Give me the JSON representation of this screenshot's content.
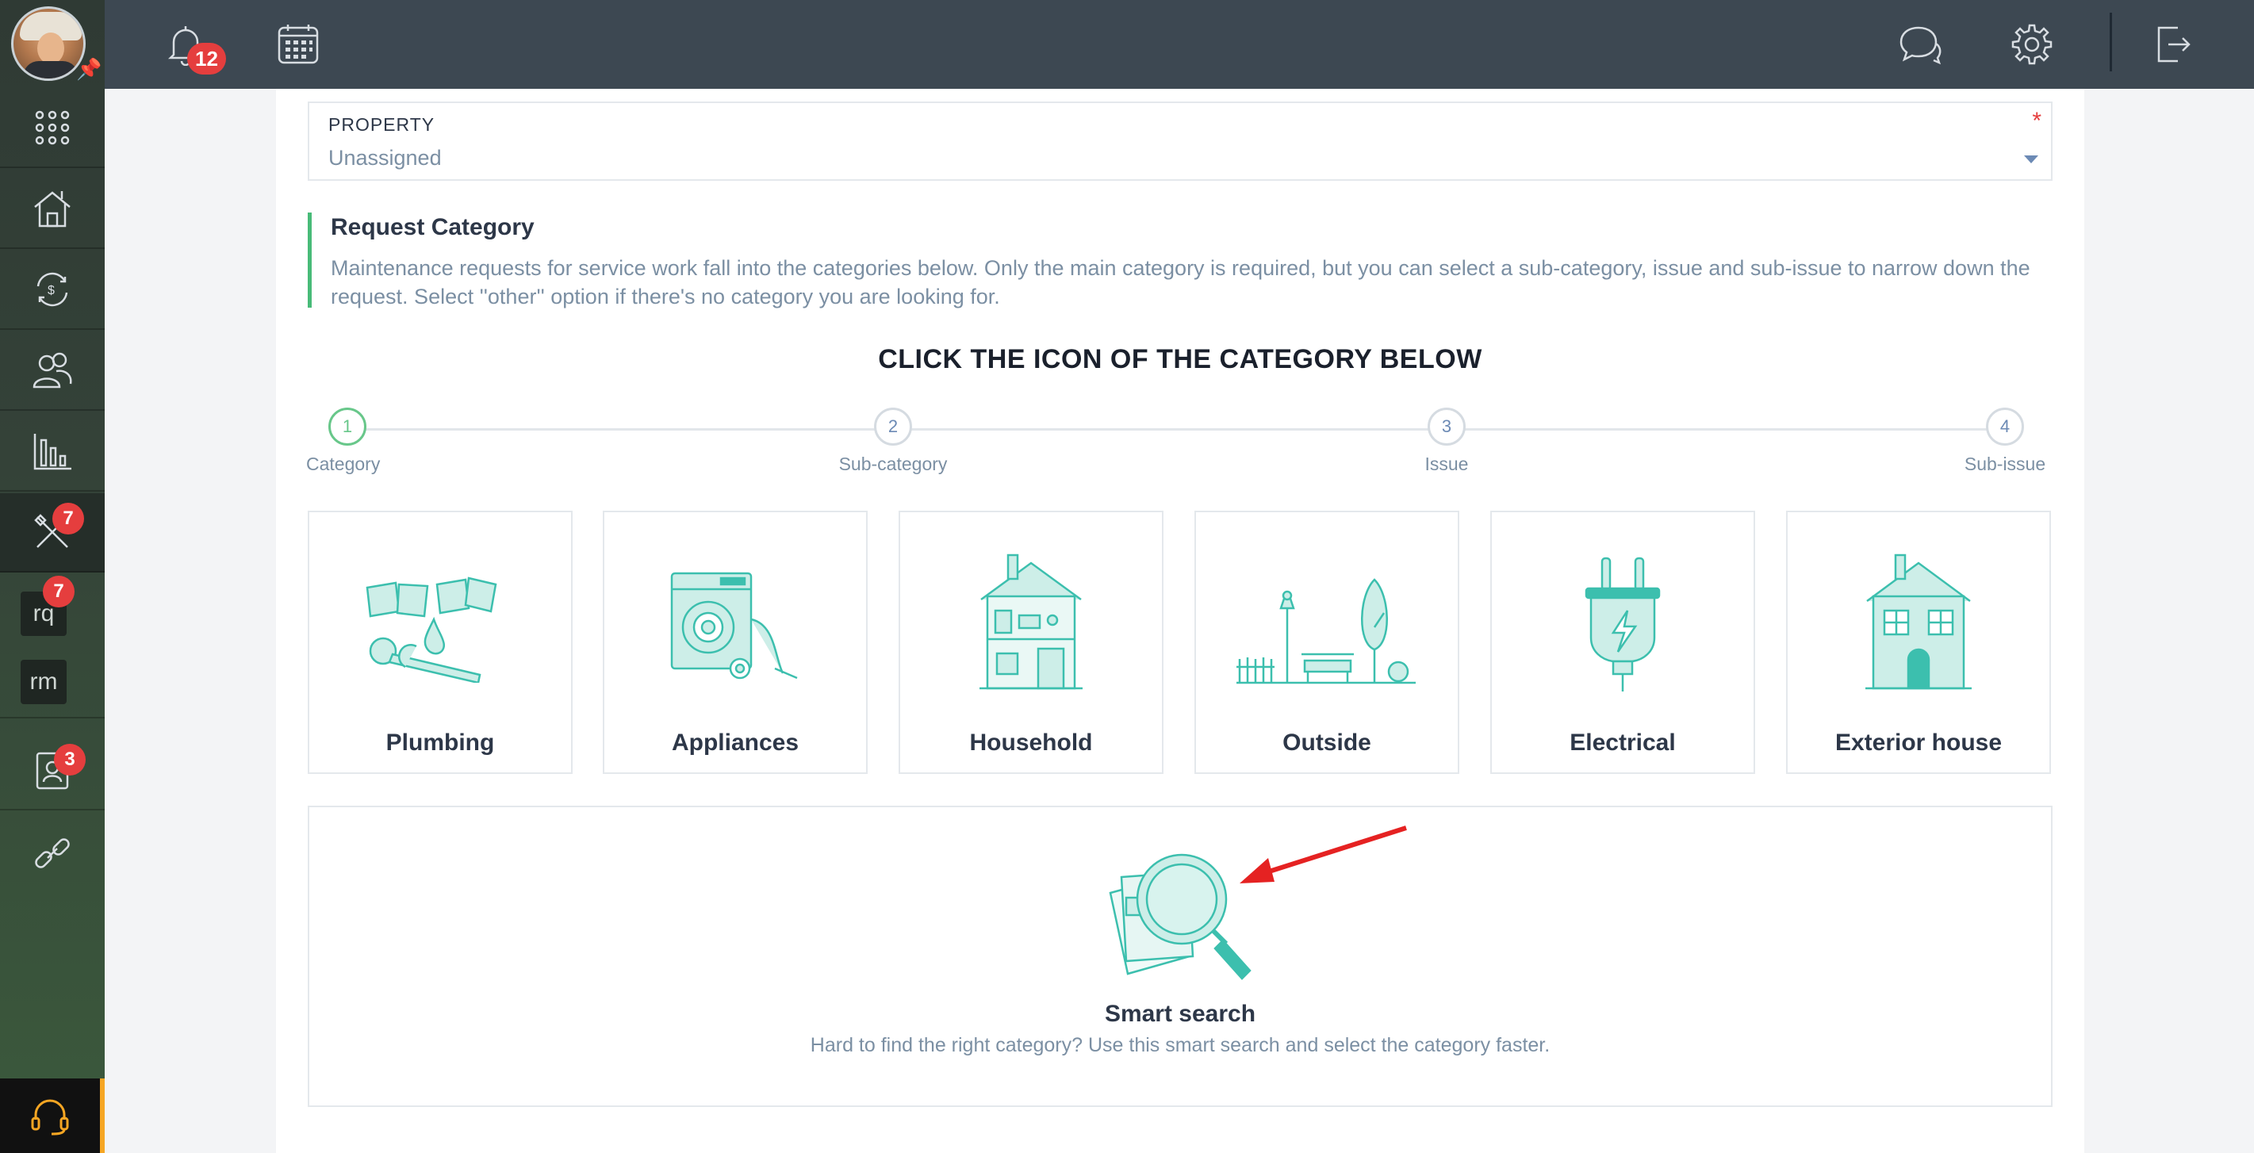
{
  "topbar": {
    "notifications_count": "12",
    "icons": [
      "bell-icon",
      "calendar-icon",
      "chat-icon",
      "gear-icon",
      "logout-icon"
    ]
  },
  "sidebar": {
    "items": [
      {
        "name": "apps-grid-icon"
      },
      {
        "name": "properties-icon"
      },
      {
        "name": "accounting-icon"
      },
      {
        "name": "contacts-icon"
      },
      {
        "name": "reports-icon"
      },
      {
        "name": "maintenance-icon",
        "badge": "7",
        "active": true
      },
      {
        "name": "rq-tile",
        "label": "rq",
        "badge": "7"
      },
      {
        "name": "rm-tile",
        "label": "rm"
      },
      {
        "name": "tenant-screening-icon",
        "badge": "3"
      },
      {
        "name": "integrations-icon"
      }
    ],
    "support_icon": "headset-icon"
  },
  "form": {
    "property": {
      "label": "PROPERTY",
      "value": "Unassigned",
      "required_mark": "*"
    },
    "request_category": {
      "title": "Request Category",
      "description": "Maintenance requests for service work fall into the categories below. Only the main category is required, but you can select a sub-category, issue and sub-issue to narrow down the request. Select ''other'' option if there's no category you are looking for."
    },
    "instruction": "CLICK THE ICON OF THE CATEGORY BELOW",
    "steps": [
      {
        "number": "1",
        "label": "Category"
      },
      {
        "number": "2",
        "label": "Sub-category"
      },
      {
        "number": "3",
        "label": "Issue"
      },
      {
        "number": "4",
        "label": "Sub-issue"
      }
    ],
    "categories": [
      {
        "label": "Plumbing",
        "icon": "plumbing-icon"
      },
      {
        "label": "Appliances",
        "icon": "appliances-icon"
      },
      {
        "label": "Household",
        "icon": "household-icon"
      },
      {
        "label": "Outside",
        "icon": "outside-icon"
      },
      {
        "label": "Electrical",
        "icon": "electrical-icon"
      },
      {
        "label": "Exterior house",
        "icon": "exterior-house-icon"
      }
    ],
    "smart_search": {
      "title": "Smart search",
      "description": "Hard to find the right category? Use this smart search and select the category faster."
    }
  },
  "colors": {
    "topbar": "#3d4852",
    "accent_teal": "#3cbfae",
    "step_active": "#68c78a",
    "badge": "#e53e3e",
    "annotation_arrow": "#e52222"
  }
}
